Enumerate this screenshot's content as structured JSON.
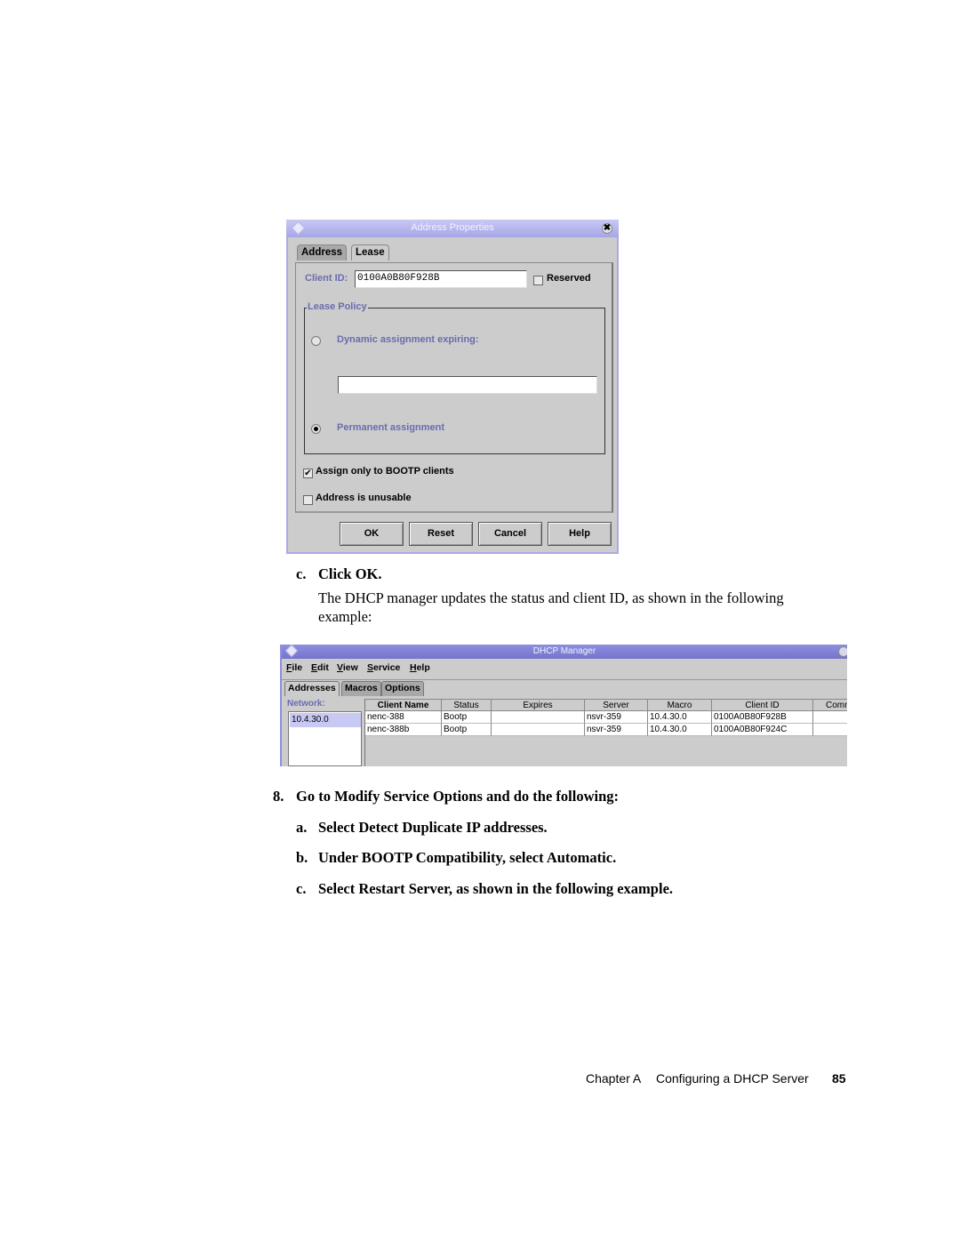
{
  "address_dialog": {
    "title": "Address Properties",
    "tabs": [
      "Address",
      "Lease"
    ],
    "active_tab": "Lease",
    "client_id_label": "Client ID:",
    "client_id_value": "0100A0B80F928B",
    "reserved_label": "Reserved",
    "reserved_checked": false,
    "lease_policy_label": "Lease Policy",
    "dynamic_label": "Dynamic assignment expiring:",
    "dynamic_selected": false,
    "dynamic_expiry_value": "",
    "permanent_label": "Permanent assignment",
    "permanent_selected": true,
    "bootp_only_label": "Assign only to BOOTP clients",
    "bootp_only_checked": true,
    "unusable_label": "Address is unusable",
    "unusable_checked": false,
    "buttons": {
      "ok": "OK",
      "reset": "Reset",
      "cancel": "Cancel",
      "help": "Help"
    },
    "check_glyph": "✔",
    "close_glyph": "✖"
  },
  "step_c_click": {
    "marker": "c.",
    "text": "Click OK."
  },
  "step_c_desc": "The DHCP manager updates the status and client ID, as shown in the following example:",
  "dhcp_manager": {
    "title": "DHCP Manager",
    "menu": [
      "File",
      "Edit",
      "View",
      "Service",
      "Help"
    ],
    "tabs": [
      "Addresses",
      "Macros",
      "Options"
    ],
    "active_tab": "Addresses",
    "network_label": "Network:",
    "networks": [
      "10.4.30.0"
    ],
    "columns": [
      "Client Name",
      "Status",
      "Expires",
      "Server",
      "Macro",
      "Client ID",
      "Comm"
    ],
    "rows": [
      [
        "nenc-388",
        "Bootp",
        "",
        "nsvr-359",
        "10.4.30.0",
        "0100A0B80F928B",
        ""
      ],
      [
        "nenc-388b",
        "Bootp",
        "",
        "nsvr-359",
        "10.4.30.0",
        "0100A0B80F924C",
        ""
      ]
    ]
  },
  "step8": {
    "marker": "8.",
    "text": "Go to Modify Service Options and do the following:"
  },
  "substeps": [
    {
      "marker": "a.",
      "text": "Select Detect Duplicate IP addresses."
    },
    {
      "marker": "b.",
      "text": "Under BOOTP Compatibility, select Automatic."
    },
    {
      "marker": "c.",
      "text": "Select Restart Server, as shown in the following example."
    }
  ],
  "footer": {
    "chapter": "Chapter A",
    "title": "Configuring a DHCP Server",
    "page": "85"
  }
}
